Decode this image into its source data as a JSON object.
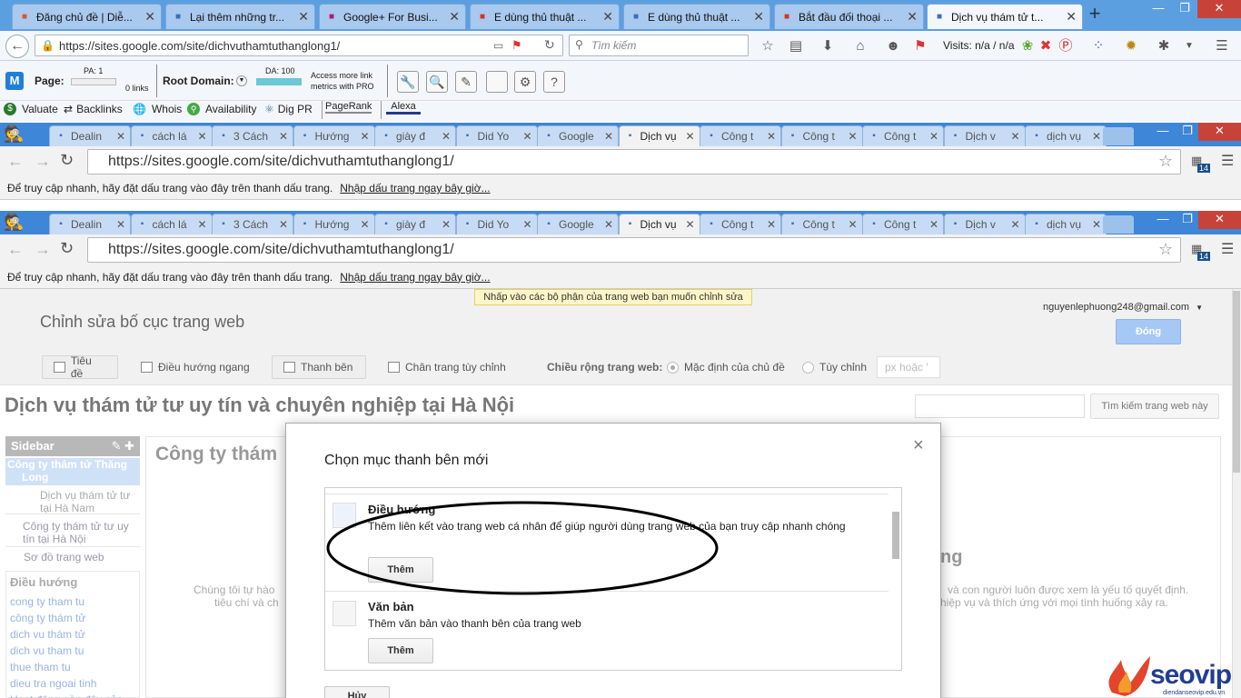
{
  "firefox": {
    "tabs": [
      {
        "label": "Đăng chủ đề | Diễ...",
        "icon": "pen-icon",
        "color": "#d9542b"
      },
      {
        "label": "Lại thêm những tr...",
        "icon": "document-icon",
        "color": "#3b6cc4"
      },
      {
        "label": "Google+ For Busi...",
        "icon": "seo-201-icon",
        "color": "#b3157a"
      },
      {
        "label": "E dùng thủ thuật ...",
        "icon": "gmail-icon",
        "color": "#d93025"
      },
      {
        "label": "E dùng thủ thuật ...",
        "icon": "document-icon",
        "color": "#3b6cc4"
      },
      {
        "label": "Bắt đầu đối thoại ...",
        "icon": "idv-icon",
        "color": "#d93025"
      },
      {
        "label": "Dịch vụ thám tử t...",
        "icon": "sites-icon",
        "color": "#3b6cc4"
      }
    ],
    "url": "https://sites.google.com/site/dichvuthamtuthanglong1/",
    "search_placeholder": "Tìm kiếm",
    "visits": "Visits: n/a / n/a"
  },
  "moz": {
    "page_label": "Page:",
    "pa": "PA: 1",
    "links": "0 links",
    "root_label": "Root Domain:",
    "da": "DA: 100",
    "access_line1": "Access more link",
    "access_line2": "metrics with PRO"
  },
  "seoquake": {
    "items": [
      "Valuate",
      "Backlinks",
      "Whois",
      "Availability",
      "Dig PR",
      "PageRank",
      "Alexa"
    ]
  },
  "chrome": {
    "tabs": [
      "Dealin",
      "cách lá",
      "3 Cách",
      "Hướng",
      "giày đ",
      "Did Yo",
      "Google",
      "Dịch vụ",
      "Công t",
      "Công t",
      "Công t",
      "Dịch v",
      "dịch vụ"
    ],
    "tab_icons": [
      "sej-icon",
      "google-icon",
      "check-icon",
      "document-icon",
      "google-icon",
      "gmail-icon",
      "sites-icon",
      "sites-icon",
      "document-icon",
      "document-icon",
      "document-icon",
      "document-icon",
      "google-icon"
    ],
    "url": "https://sites.google.com/site/dichvuthamtuthanglong1/",
    "bookmark_text": "Để truy cập nhanh, hãy đặt dấu trang vào đây trên thanh dấu trang.",
    "bookmark_link": "Nhập dấu trang ngay bây giờ...",
    "ext_badge": "14"
  },
  "sites": {
    "hint": "Nhấp vào các bộ phận của trang web bạn muốn chỉnh sửa",
    "editor_title": "Chỉnh sửa bố cục trang web",
    "email": "nguyenlephuong248@gmail.com",
    "close_button": "Đóng",
    "toolbar": {
      "title": "Tiêu đề",
      "horizontal_nav": "Điều hướng ngang",
      "sidebar": "Thanh bên",
      "custom_footer": "Chân trang tùy chỉnh",
      "width_label": "Chiều rộng trang web:",
      "default_theme": "Mặc định của chủ đề",
      "custom": "Tùy chỉnh",
      "px_placeholder": "px hoặc '"
    },
    "site_title": "Dịch vụ thám tử tư uy tín và chuyên nghiệp tại Hà Nội",
    "search_button": "Tìm kiếm trang web này",
    "sidebar": {
      "heading": "Sidebar",
      "items": [
        "Công ty thám tử Thăng Long",
        "Dịch vụ thám tử tư tại Hà Nam",
        "Công ty thám tử tư uy tín tại Hà Nội",
        "Sơ đồ trang web"
      ],
      "nav_heading": "Điều hướng",
      "nav_links": [
        "cong ty tham tu",
        "công ty thám tử",
        "dich vu thám tử",
        "dich vu tham tu",
        "thue tham tu",
        "dieu tra ngoai tinh",
        "Hoạt động gần đây của"
      ]
    },
    "main_heading": "Công ty thám",
    "bg_text_left_1": "Chúng tôi tự hào",
    "bg_text_left_2": "tiêu chí và ch",
    "bg_heading_right": "ng",
    "bg_text_right_1": "và con người luôn được xem là yếu tố quyết định.",
    "bg_text_right_2": "hiệp vụ và thích ứng với mọi tình huống xảy ra."
  },
  "dialog": {
    "title": "Chọn mục thanh bên mới",
    "gadgets": [
      {
        "name": "Điều hướng",
        "desc": "Thêm liên kết vào trang web cá nhân để giúp người dùng trang web của bạn truy cập nhanh chóng",
        "button": "Thêm"
      },
      {
        "name": "Văn bản",
        "desc": "Thêm văn bản vào thanh bên của trang web",
        "button": "Thêm"
      }
    ],
    "cancel": "Hủy"
  },
  "watermark": {
    "brand": "seovip",
    "domain": "diendanseovip.edu.vn"
  }
}
